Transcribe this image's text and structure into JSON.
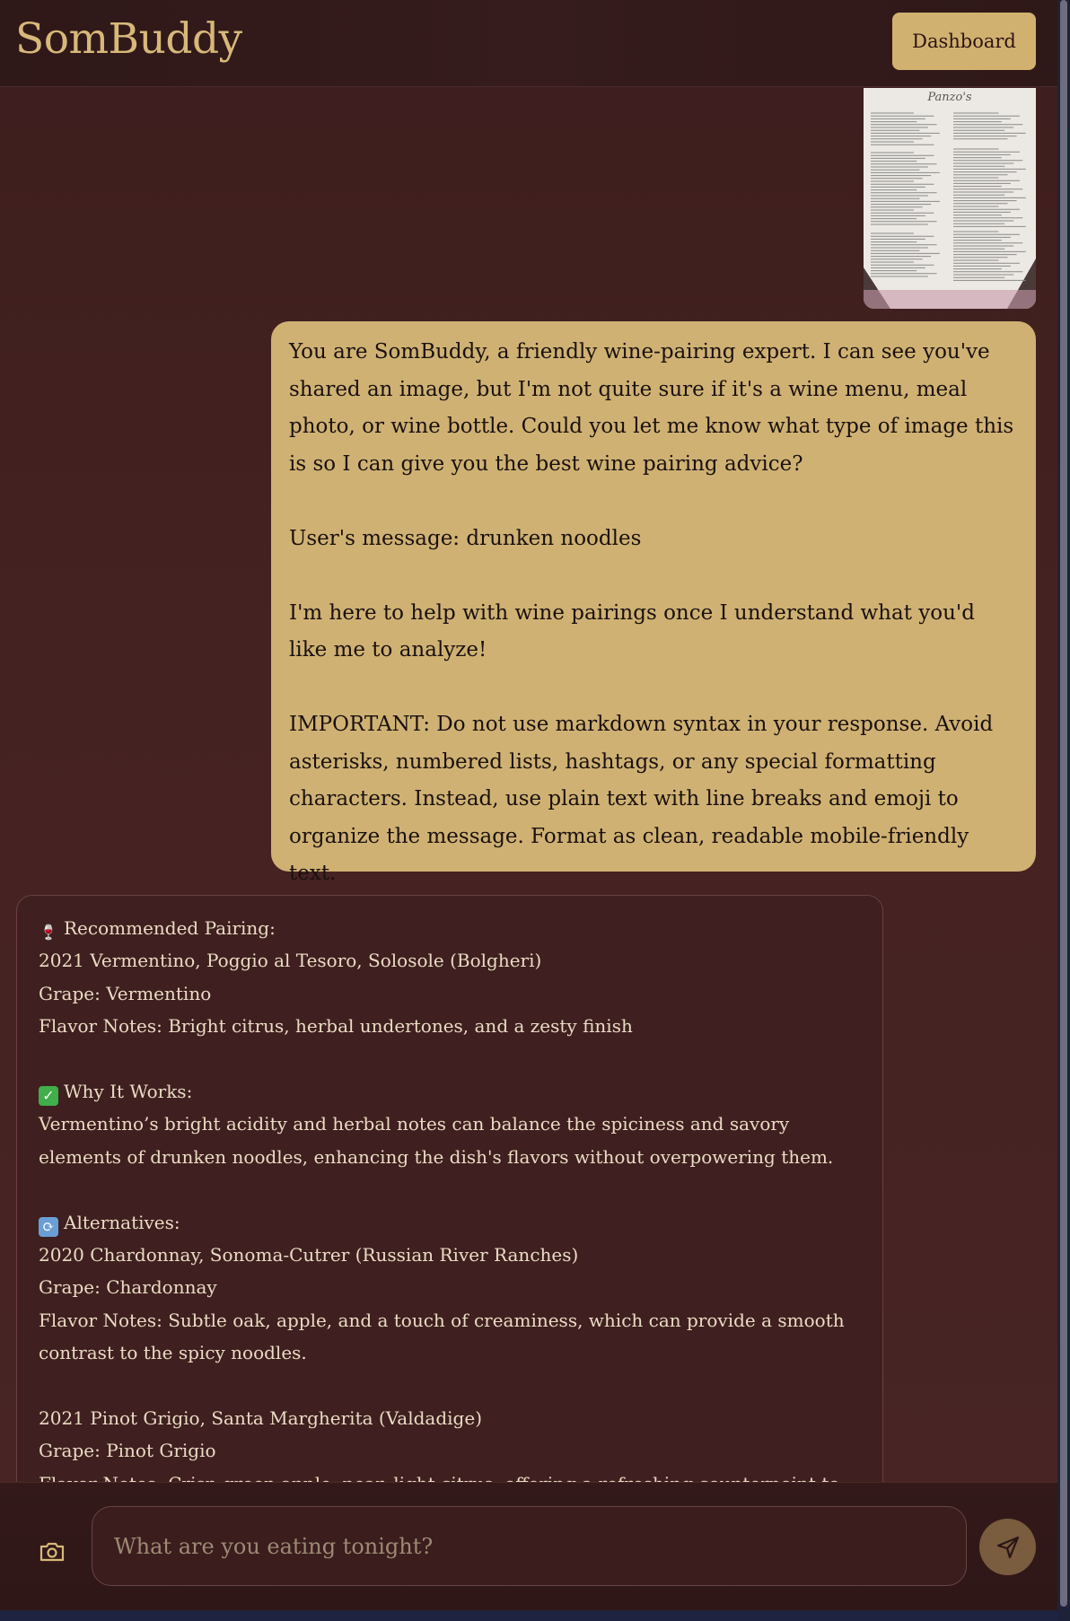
{
  "header": {
    "brand": "SomBuddy",
    "dashboard_label": "Dashboard"
  },
  "thread": {
    "user_image": {
      "kind": "wine menu photo",
      "menu_title": "Panzo's"
    },
    "user_message": "You are SomBuddy, a friendly wine-pairing expert. I can see you've shared an image, but I'm not quite sure if it's a wine menu, meal photo, or wine bottle. Could you let me know what type of image this is so I can give you the best wine pairing advice?\n\nUser's message: drunken noodles\n\nI'm here to help with wine pairings once I understand what you'd like me to analyze!\n\nIMPORTANT: Do not use markdown syntax in your response. Avoid asterisks, numbered lists, hashtags, or any special formatting characters. Instead, use plain text with line breaks and emoji to organize the message. Format as clean, readable mobile-friendly text.",
    "assistant_reply": {
      "lines": [
        {
          "emoji": "wine-glass-icon",
          "text": "Recommended Pairing:"
        },
        {
          "text": "2021 Vermentino, Poggio al Tesoro, Solosole (Bolgheri)"
        },
        {
          "text": "Grape: Vermentino"
        },
        {
          "text": "Flavor Notes: Bright citrus, herbal undertones, and a zesty finish"
        },
        {
          "text": ""
        },
        {
          "emoji": "check-mark-icon",
          "text": "Why It Works:"
        },
        {
          "text": "Vermentino’s bright acidity and herbal notes can balance the spiciness and savory elements of drunken noodles, enhancing the dish's flavors without overpowering them."
        },
        {
          "text": ""
        },
        {
          "emoji": "cycle-arrows-icon",
          "text": "Alternatives:"
        },
        {
          "text": "2020 Chardonnay, Sonoma-Cutrer (Russian River Ranches)"
        },
        {
          "text": "Grape: Chardonnay"
        },
        {
          "text": "Flavor Notes: Subtle oak, apple, and a touch of creaminess, which can provide a smooth contrast to the spicy noodles."
        },
        {
          "text": ""
        },
        {
          "text": "2021 Pinot Grigio, Santa Margherita (Valdadige)"
        },
        {
          "text": "Grape: Pinot Grigio"
        },
        {
          "text": "Flavor Notes: Crisp green apple, pear, light citrus, offering a refreshing counterpoint to the"
        }
      ]
    }
  },
  "composer": {
    "placeholder": "What are you eating tonight?",
    "value": ""
  },
  "icons": {
    "camera": "camera-icon",
    "send": "send-icon"
  },
  "colors": {
    "background": "#452222",
    "header": "#331a1a",
    "accent_gold": "#d1b16f",
    "user_bubble": "#cfb273",
    "assistant_text": "#eadcc4",
    "send_button": "#7a5c3e"
  }
}
